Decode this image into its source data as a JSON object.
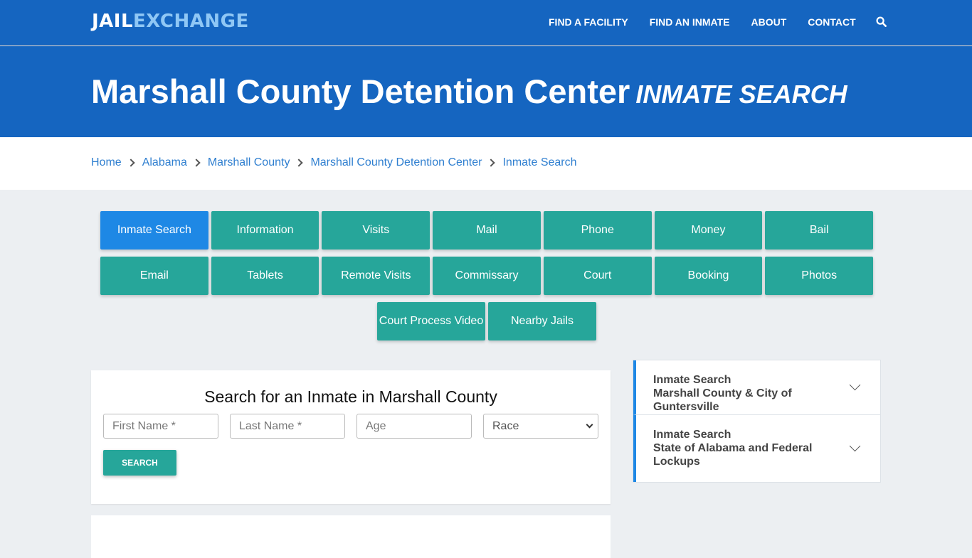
{
  "header": {
    "logo": {
      "part1": "JAIL",
      "part2": "EXCHANGE"
    },
    "nav": [
      {
        "label": "FIND A FACILITY"
      },
      {
        "label": "FIND AN INMATE"
      },
      {
        "label": "ABOUT"
      },
      {
        "label": "CONTACT"
      }
    ],
    "search_icon": "search-icon"
  },
  "hero": {
    "title": "Marshall County Detention Center",
    "subtitle": "INMATE SEARCH"
  },
  "breadcrumb": [
    {
      "label": "Home"
    },
    {
      "label": "Alabama"
    },
    {
      "label": "Marshall County"
    },
    {
      "label": "Marshall County Detention Center"
    },
    {
      "label": "Inmate Search"
    }
  ],
  "tabs": {
    "row1": [
      "Inmate Search",
      "Information",
      "Visits",
      "Mail",
      "Phone",
      "Money",
      "Bail"
    ],
    "row2": [
      "Email",
      "Tablets",
      "Remote Visits",
      "Commissary",
      "Court",
      "Booking",
      "Photos"
    ],
    "row3": [
      "Court Process Video",
      "Nearby Jails"
    ],
    "active": "Inmate Search"
  },
  "search_form": {
    "title": "Search for an Inmate in Marshall County",
    "first_name_placeholder": "First Name *",
    "last_name_placeholder": "Last Name *",
    "age_placeholder": "Age",
    "race_selected": "Race",
    "search_label": "SEARCH"
  },
  "sidebar": {
    "items": [
      {
        "line1": "Inmate Search",
        "line2": "Marshall County & City of Guntersville"
      },
      {
        "line1": "Inmate Search",
        "line2": "State of Alabama and Federal Lockups"
      }
    ]
  },
  "colors": {
    "primary": "#1565c0",
    "active_tab": "#1e88e5",
    "teal": "#26a69a",
    "link": "#2f7fd0"
  }
}
